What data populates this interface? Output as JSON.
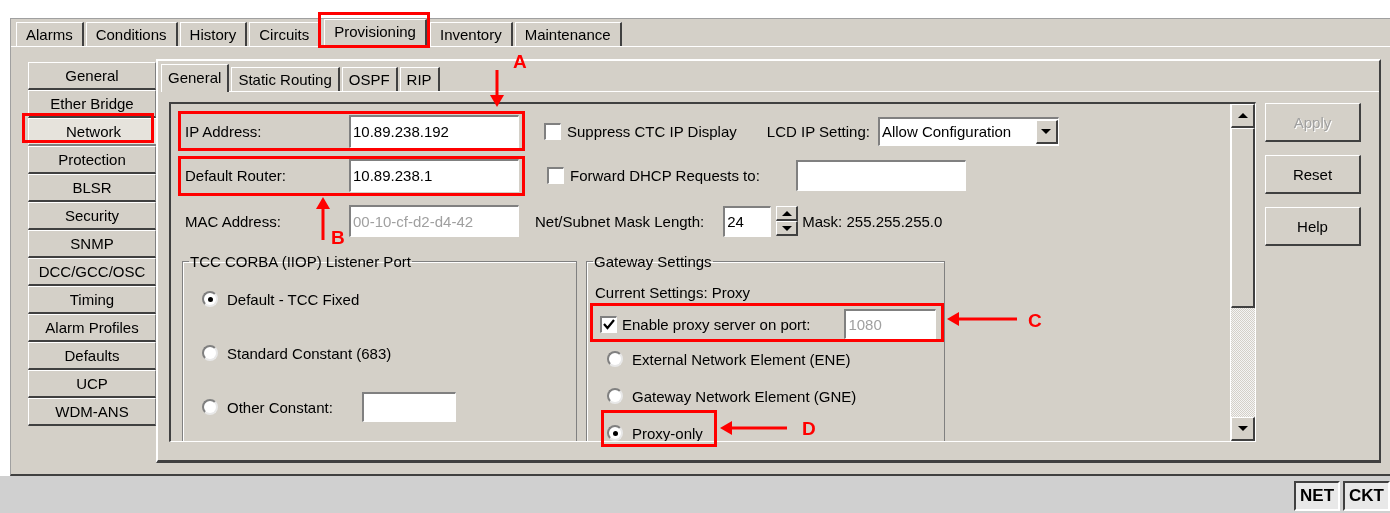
{
  "main_tabs": [
    {
      "label": "Alarms",
      "selected": false
    },
    {
      "label": "Conditions",
      "selected": false
    },
    {
      "label": "History",
      "selected": false
    },
    {
      "label": "Circuits",
      "selected": false
    },
    {
      "label": "Provisioning",
      "selected": true
    },
    {
      "label": "Inventory",
      "selected": false
    },
    {
      "label": "Maintenance",
      "selected": false
    }
  ],
  "nav_items": [
    {
      "label": "General",
      "selected": false
    },
    {
      "label": "Ether Bridge",
      "selected": false
    },
    {
      "label": "Network",
      "selected": true
    },
    {
      "label": "Protection",
      "selected": false
    },
    {
      "label": "BLSR",
      "selected": false
    },
    {
      "label": "Security",
      "selected": false
    },
    {
      "label": "SNMP",
      "selected": false
    },
    {
      "label": "DCC/GCC/OSC",
      "selected": false
    },
    {
      "label": "Timing",
      "selected": false
    },
    {
      "label": "Alarm Profiles",
      "selected": false
    },
    {
      "label": "Defaults",
      "selected": false
    },
    {
      "label": "UCP",
      "selected": false
    },
    {
      "label": "WDM-ANS",
      "selected": false
    }
  ],
  "sub_tabs": [
    {
      "label": "General",
      "selected": true
    },
    {
      "label": "Static Routing",
      "selected": false
    },
    {
      "label": "OSPF",
      "selected": false
    },
    {
      "label": "RIP",
      "selected": false
    }
  ],
  "ip_address": {
    "label": "IP Address:",
    "value": "10.89.238.192"
  },
  "suppress_ctc": {
    "label": "Suppress CTC IP Display",
    "checked": false
  },
  "lcd_ip_setting": {
    "label": "LCD IP Setting:",
    "value": "Allow Configuration"
  },
  "default_router": {
    "label": "Default Router:",
    "value": "10.89.238.1"
  },
  "forward_dhcp": {
    "label": "Forward DHCP Requests to:",
    "checked": false
  },
  "mac_address": {
    "label": "MAC Address:",
    "value": "00-10-cf-d2-d4-42",
    "disabled": true
  },
  "mask_length": {
    "label": "Net/Subnet Mask Length:",
    "value": "24"
  },
  "mask": "Mask: 255.255.255.0",
  "tcc_group": {
    "title": "TCC CORBA (IIOP) Listener Port",
    "options": [
      {
        "kind": "radio",
        "label": "Default - TCC Fixed",
        "selected": true
      },
      {
        "kind": "radio",
        "label": "Standard Constant (683)",
        "selected": false
      },
      {
        "kind": "radio-input",
        "label": "Other Constant:",
        "selected": false
      }
    ]
  },
  "gateway_group": {
    "title": "Gateway Settings",
    "current": "Current Settings: Proxy",
    "proxy": {
      "label": "Enable proxy server on port:",
      "checked": true,
      "value": "1080",
      "disabled": true
    },
    "options": [
      {
        "label": "External Network Element (ENE)",
        "selected": false
      },
      {
        "label": "Gateway Network Element (GNE)",
        "selected": false
      },
      {
        "label": "Proxy-only",
        "selected": true
      }
    ]
  },
  "buttons": [
    {
      "label": "Apply",
      "disabled": true
    },
    {
      "label": "Reset",
      "disabled": false
    },
    {
      "label": "Help",
      "disabled": false
    }
  ],
  "status_buttons": [
    {
      "label": "NET"
    },
    {
      "label": "CKT"
    }
  ],
  "callouts": [
    {
      "label": "A"
    },
    {
      "label": "B"
    },
    {
      "label": "C"
    },
    {
      "label": "D"
    }
  ]
}
